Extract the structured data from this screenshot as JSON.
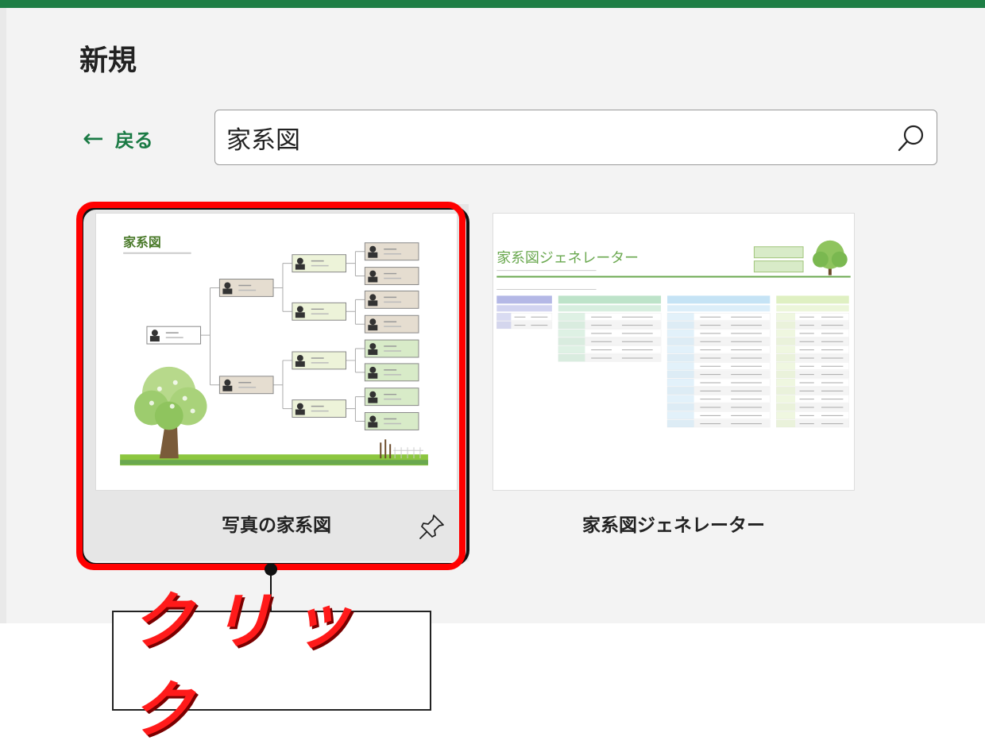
{
  "header": {
    "title": "新規"
  },
  "nav": {
    "back_label": "戻る",
    "back_arrow": "←"
  },
  "search": {
    "value": "家系図"
  },
  "templates": [
    {
      "label": "写真の家系図",
      "thumb_title": "家系図",
      "tree_color": "#6aa84f",
      "box_colors": [
        "#e5ddd0",
        "#edf3d9",
        "#d8ebc8"
      ]
    },
    {
      "label": "家系図ジェネレーター",
      "thumb_title": "家系図ジェネレーター",
      "header_colors": [
        "#b4b8e6",
        "#bde3c9",
        "#c5e3f5",
        "#dff0c2"
      ]
    }
  ],
  "annotation": {
    "callout": "クリック",
    "highlight_color": "#ff0000"
  },
  "colors": {
    "accent": "#1e7e45",
    "link": "#1a7a44"
  }
}
